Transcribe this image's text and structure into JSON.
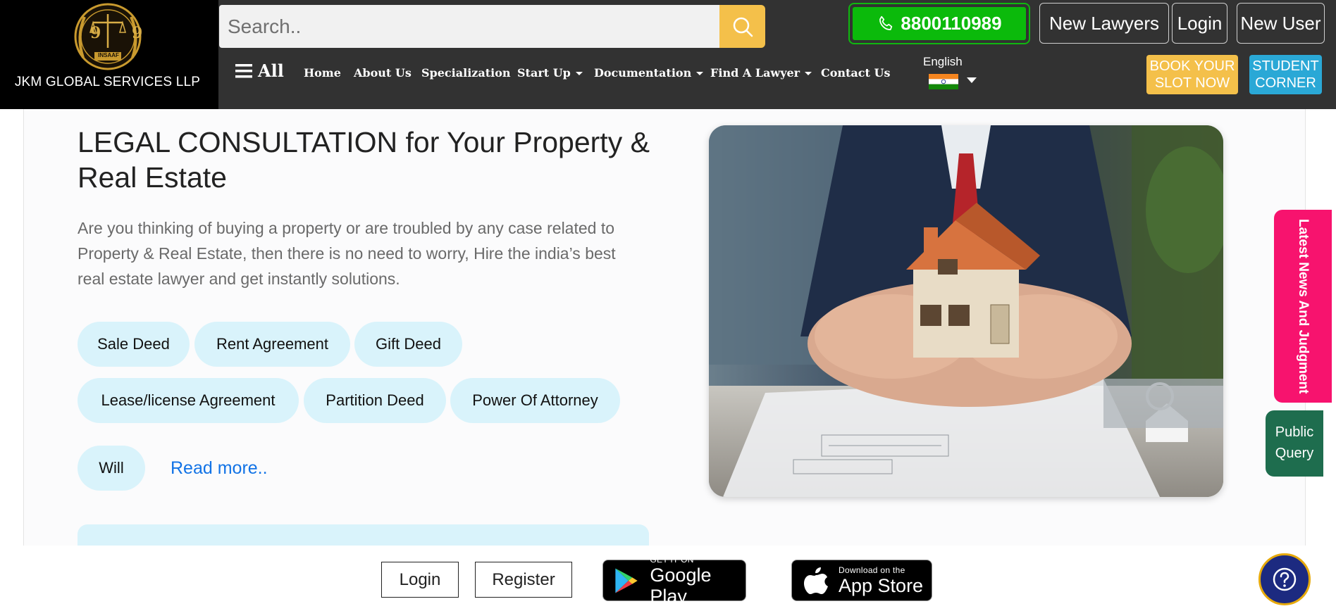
{
  "header": {
    "logo_numbers": "9 9",
    "logo_badge": "INSAAF",
    "company_name": "JKM GLOBAL SERVICES LLP",
    "search_placeholder": "Search..",
    "phone": "8800110989",
    "new_lawyers": "New Lawyers",
    "login": "Login",
    "new_user": "New User",
    "all_label": "All",
    "nav": [
      {
        "label": "Home"
      },
      {
        "label": "About Us"
      },
      {
        "label": "Specialization"
      },
      {
        "label": "Start Up"
      },
      {
        "label": "Documentation"
      },
      {
        "label": "Find A Lawyer"
      },
      {
        "label": "Contact Us"
      }
    ],
    "language": "English",
    "book_line1": "BOOK YOUR",
    "book_line2": "SLOT NOW",
    "student_line1": "STUDENT",
    "student_line2": "CORNER"
  },
  "main": {
    "title": "LEGAL CONSULTATION for Your Property & Real Estate",
    "description": "Are you thinking of buying a property or are troubled by any case related to Property & Real Estate, then there is no need to worry, Hire the india’s best real estate lawyer and get instantly solutions.",
    "chips": [
      "Sale Deed",
      "Rent Agreement",
      "Gift Deed",
      "Lease/license Agreement",
      "Partition Deed",
      "Power Of Attorney",
      "Will"
    ],
    "read_more": "Read more.."
  },
  "side": {
    "news": "Latest News And Judgment",
    "query_line1": "Public",
    "query_line2": "Query"
  },
  "bottom": {
    "login": "Login",
    "register": "Register",
    "google_small": "GET IT ON",
    "google_big": "Google Play",
    "apple_small": "Download on the",
    "apple_big": "App Store"
  },
  "colors": {
    "header_bg": "#323232",
    "accent_yellow": "#f4c04a",
    "phone_green": "#0bba0b",
    "chip_bg": "#d9f3fb",
    "link_blue": "#1273e6",
    "news_pink": "#f7136e",
    "query_green": "#1e6d4e",
    "help_navy": "#1c2a80"
  },
  "icons": {
    "search": "search-icon",
    "phone": "phone-icon",
    "menu": "hamburger-icon",
    "flag": "india-flag-icon",
    "help": "question-icon"
  }
}
